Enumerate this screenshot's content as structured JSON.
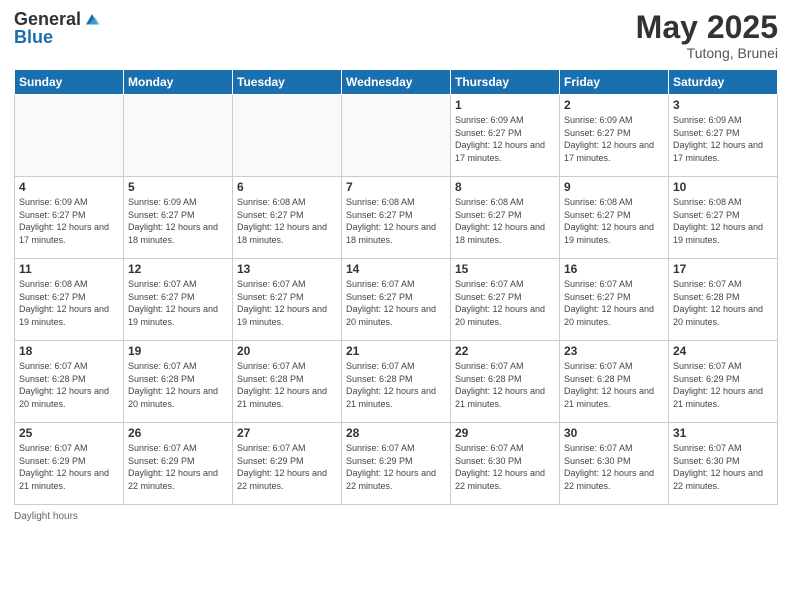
{
  "header": {
    "logo_general": "General",
    "logo_blue": "Blue",
    "month_title": "May 2025",
    "location": "Tutong, Brunei"
  },
  "days_of_week": [
    "Sunday",
    "Monday",
    "Tuesday",
    "Wednesday",
    "Thursday",
    "Friday",
    "Saturday"
  ],
  "footer": {
    "daylight_label": "Daylight hours"
  },
  "weeks": [
    {
      "days": [
        {
          "number": "",
          "info": ""
        },
        {
          "number": "",
          "info": ""
        },
        {
          "number": "",
          "info": ""
        },
        {
          "number": "",
          "info": ""
        },
        {
          "number": "1",
          "info": "Sunrise: 6:09 AM\nSunset: 6:27 PM\nDaylight: 12 hours and 17 minutes."
        },
        {
          "number": "2",
          "info": "Sunrise: 6:09 AM\nSunset: 6:27 PM\nDaylight: 12 hours and 17 minutes."
        },
        {
          "number": "3",
          "info": "Sunrise: 6:09 AM\nSunset: 6:27 PM\nDaylight: 12 hours and 17 minutes."
        }
      ]
    },
    {
      "days": [
        {
          "number": "4",
          "info": "Sunrise: 6:09 AM\nSunset: 6:27 PM\nDaylight: 12 hours and 17 minutes."
        },
        {
          "number": "5",
          "info": "Sunrise: 6:09 AM\nSunset: 6:27 PM\nDaylight: 12 hours and 18 minutes."
        },
        {
          "number": "6",
          "info": "Sunrise: 6:08 AM\nSunset: 6:27 PM\nDaylight: 12 hours and 18 minutes."
        },
        {
          "number": "7",
          "info": "Sunrise: 6:08 AM\nSunset: 6:27 PM\nDaylight: 12 hours and 18 minutes."
        },
        {
          "number": "8",
          "info": "Sunrise: 6:08 AM\nSunset: 6:27 PM\nDaylight: 12 hours and 18 minutes."
        },
        {
          "number": "9",
          "info": "Sunrise: 6:08 AM\nSunset: 6:27 PM\nDaylight: 12 hours and 19 minutes."
        },
        {
          "number": "10",
          "info": "Sunrise: 6:08 AM\nSunset: 6:27 PM\nDaylight: 12 hours and 19 minutes."
        }
      ]
    },
    {
      "days": [
        {
          "number": "11",
          "info": "Sunrise: 6:08 AM\nSunset: 6:27 PM\nDaylight: 12 hours and 19 minutes."
        },
        {
          "number": "12",
          "info": "Sunrise: 6:07 AM\nSunset: 6:27 PM\nDaylight: 12 hours and 19 minutes."
        },
        {
          "number": "13",
          "info": "Sunrise: 6:07 AM\nSunset: 6:27 PM\nDaylight: 12 hours and 19 minutes."
        },
        {
          "number": "14",
          "info": "Sunrise: 6:07 AM\nSunset: 6:27 PM\nDaylight: 12 hours and 20 minutes."
        },
        {
          "number": "15",
          "info": "Sunrise: 6:07 AM\nSunset: 6:27 PM\nDaylight: 12 hours and 20 minutes."
        },
        {
          "number": "16",
          "info": "Sunrise: 6:07 AM\nSunset: 6:27 PM\nDaylight: 12 hours and 20 minutes."
        },
        {
          "number": "17",
          "info": "Sunrise: 6:07 AM\nSunset: 6:28 PM\nDaylight: 12 hours and 20 minutes."
        }
      ]
    },
    {
      "days": [
        {
          "number": "18",
          "info": "Sunrise: 6:07 AM\nSunset: 6:28 PM\nDaylight: 12 hours and 20 minutes."
        },
        {
          "number": "19",
          "info": "Sunrise: 6:07 AM\nSunset: 6:28 PM\nDaylight: 12 hours and 20 minutes."
        },
        {
          "number": "20",
          "info": "Sunrise: 6:07 AM\nSunset: 6:28 PM\nDaylight: 12 hours and 21 minutes."
        },
        {
          "number": "21",
          "info": "Sunrise: 6:07 AM\nSunset: 6:28 PM\nDaylight: 12 hours and 21 minutes."
        },
        {
          "number": "22",
          "info": "Sunrise: 6:07 AM\nSunset: 6:28 PM\nDaylight: 12 hours and 21 minutes."
        },
        {
          "number": "23",
          "info": "Sunrise: 6:07 AM\nSunset: 6:28 PM\nDaylight: 12 hours and 21 minutes."
        },
        {
          "number": "24",
          "info": "Sunrise: 6:07 AM\nSunset: 6:29 PM\nDaylight: 12 hours and 21 minutes."
        }
      ]
    },
    {
      "days": [
        {
          "number": "25",
          "info": "Sunrise: 6:07 AM\nSunset: 6:29 PM\nDaylight: 12 hours and 21 minutes."
        },
        {
          "number": "26",
          "info": "Sunrise: 6:07 AM\nSunset: 6:29 PM\nDaylight: 12 hours and 22 minutes."
        },
        {
          "number": "27",
          "info": "Sunrise: 6:07 AM\nSunset: 6:29 PM\nDaylight: 12 hours and 22 minutes."
        },
        {
          "number": "28",
          "info": "Sunrise: 6:07 AM\nSunset: 6:29 PM\nDaylight: 12 hours and 22 minutes."
        },
        {
          "number": "29",
          "info": "Sunrise: 6:07 AM\nSunset: 6:30 PM\nDaylight: 12 hours and 22 minutes."
        },
        {
          "number": "30",
          "info": "Sunrise: 6:07 AM\nSunset: 6:30 PM\nDaylight: 12 hours and 22 minutes."
        },
        {
          "number": "31",
          "info": "Sunrise: 6:07 AM\nSunset: 6:30 PM\nDaylight: 12 hours and 22 minutes."
        }
      ]
    }
  ]
}
